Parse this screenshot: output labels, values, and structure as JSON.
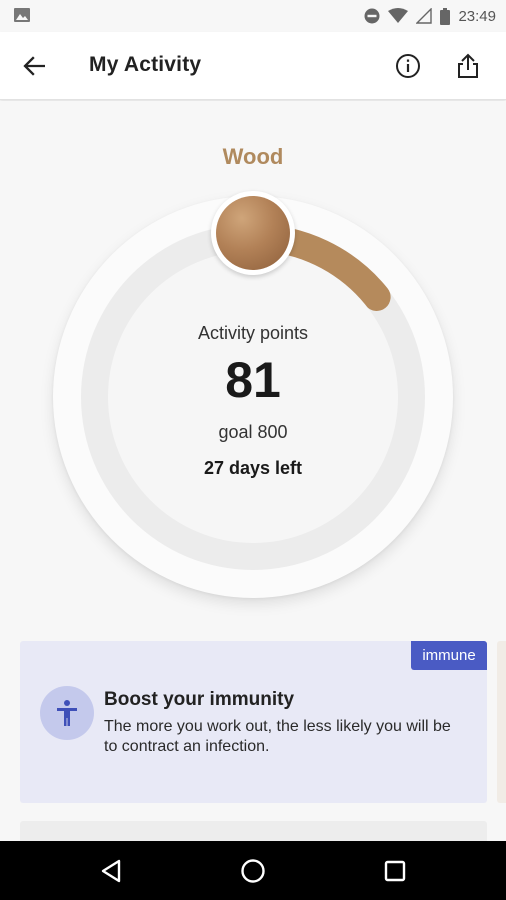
{
  "status_bar": {
    "time": "23:49",
    "icons": [
      "image-icon",
      "do-not-disturb-icon",
      "wifi-icon",
      "signal-icon",
      "battery-icon"
    ]
  },
  "app_bar": {
    "title": "My Activity",
    "icons": [
      "back-arrow-icon",
      "info-icon",
      "share-icon"
    ]
  },
  "level": {
    "name": "Wood",
    "color": "#b08a5e",
    "badge_icon": "wood-medal-icon"
  },
  "activity": {
    "label": "Activity points",
    "value": "81",
    "goal": "goal 800",
    "days_left": "27 days left",
    "progress": 0.10125,
    "progress_color": "#b58a5c"
  },
  "card": {
    "tag": "immune",
    "title": "Boost your immunity",
    "body": "The more you work out, the less likely you will be to contract an infection.",
    "icon": "person-accessibility-icon",
    "tag_color": "#4a5bc4",
    "background": "#e8e9f6"
  },
  "nav_bar": {
    "buttons": [
      "back-triangle-icon",
      "home-circle-icon",
      "recents-square-icon"
    ]
  }
}
